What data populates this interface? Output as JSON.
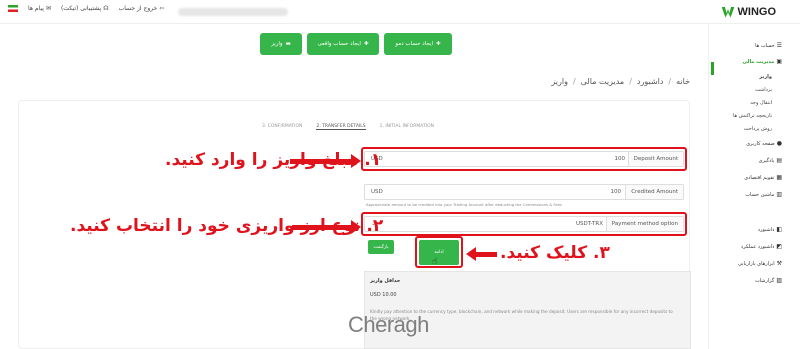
{
  "topbar": {
    "brand": "WINGO",
    "logout_label": "خروج از حساب",
    "support_label": "پشتیبانی (تیکت)",
    "messages_label": "پیام ها"
  },
  "sidebar": {
    "items": [
      {
        "label": "حساب ها",
        "icon": "list-icon"
      },
      {
        "label": "مدیریت مالی",
        "icon": "wallet-icon"
      },
      {
        "label": "واریز"
      },
      {
        "label": "برداشت"
      },
      {
        "label": "انتقال وجه"
      },
      {
        "label": "تاریخچه تراکنش ها"
      },
      {
        "label": "روش پرداخت"
      },
      {
        "label": "صفحه کاربری",
        "icon": "user-icon"
      },
      {
        "label": "یادگیری",
        "icon": "learn-icon"
      },
      {
        "label": "تقویم اقتصادی",
        "icon": "calendar-icon"
      },
      {
        "label": "ماشین حساب",
        "icon": "calculator-icon"
      },
      {
        "label": "داشبورد",
        "icon": "dashboard-icon"
      },
      {
        "label": "داشبورد عملکرد",
        "icon": "chart-icon"
      },
      {
        "label": "ابزارهای بازاریابی",
        "icon": "tools-icon"
      },
      {
        "label": "گزارشات",
        "icon": "report-icon"
      }
    ]
  },
  "actions": {
    "demo_label": "ایجاد حساب دمو",
    "real_label": "ایجاد حساب واقعی",
    "deposit_label": "واریز"
  },
  "breadcrumb": [
    "خانه",
    "داشبورد",
    "مدیریت مالی",
    "واریز"
  ],
  "steps": [
    "1. INITIAL INFORMATION",
    "2. TRANSFER DETAILS",
    "3. CONFIRMATION"
  ],
  "form": {
    "deposit_amount": {
      "currency": "USD",
      "value": "100",
      "label": "Deposit Amount"
    },
    "credited_amount": {
      "currency": "USD",
      "value": "100",
      "label": "Credited Amount"
    },
    "helper": "Approximate amount to be credited into your Trading Account after deducting the Commissions & Fees",
    "payment_method": {
      "value": "USDT-TRX",
      "label": "Payment method option"
    },
    "back_label": "بازگشت",
    "submit_label": "ادامه"
  },
  "info": {
    "title": "حداقل واریز",
    "min": "USD 10.00",
    "note": "Kindly pay attention to the currency type, blockchain, and network while making the deposit. Users are responsible for any incorrect deposits to the wrong network."
  },
  "annotations": {
    "step1": "۱. مبلغ واریز را وارد کنید.",
    "step2": "۲. نوع ارز واریزی خود را انتخاب کنید.",
    "step3": "۳. کلیک کنید."
  },
  "colors": {
    "accent": "#36b54a",
    "highlight": "#e0121b"
  },
  "watermark": "Cheragh"
}
